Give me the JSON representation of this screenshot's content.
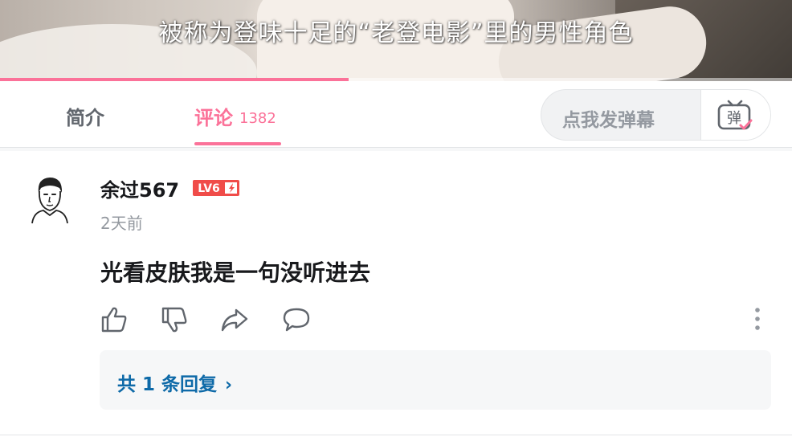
{
  "video": {
    "subtitle": "被称为登味十足的“老登电影”里的男性角色",
    "progress_percent": 44
  },
  "tabs": {
    "intro": "简介",
    "comments": "评论",
    "comment_count": "1382"
  },
  "danmaku": {
    "placeholder": "点我发弹幕",
    "button_glyph": "弹"
  },
  "comment": {
    "username": "余过567",
    "level": "LV6",
    "time": "2天前",
    "content": "光看皮肤我是一句没听进去",
    "actions": [
      "like-icon",
      "dislike-icon",
      "share-icon",
      "reply-icon"
    ],
    "more": "more-icon"
  },
  "replies": {
    "label": "共 1 条回复",
    "chevron": "›"
  },
  "colors": {
    "accent": "#fb7299",
    "level_badge": "#f04c49",
    "link": "#0e6aa8"
  }
}
